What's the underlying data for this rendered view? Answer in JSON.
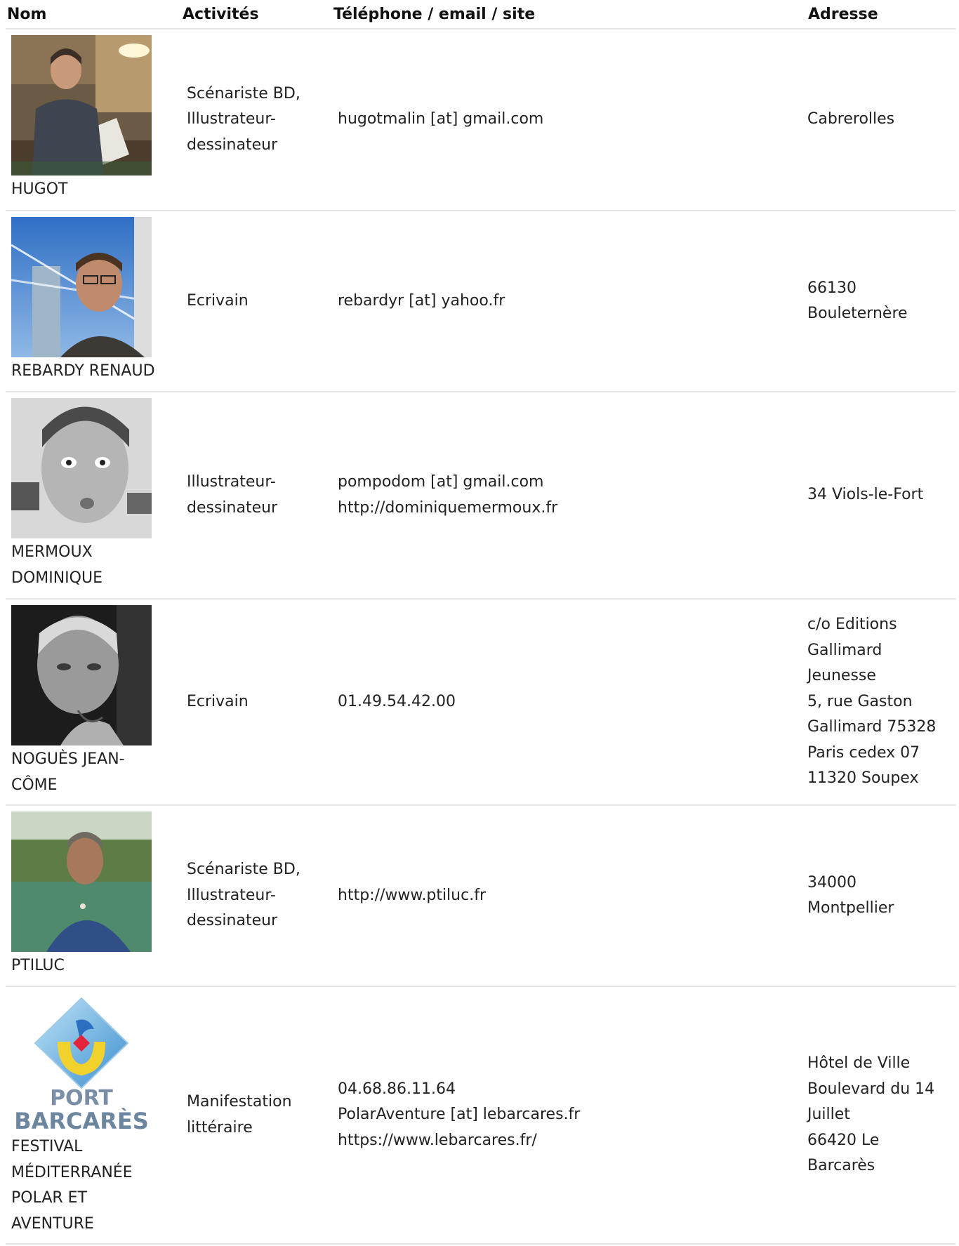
{
  "headers": {
    "nom": "Nom",
    "activites": "Activités",
    "contact": "Téléphone / email / site",
    "adresse": "Adresse"
  },
  "rows": [
    {
      "photo_icon": "person-drawing-at-desk-photo",
      "name_lines": [
        "HUGOT"
      ],
      "activity_lines": [
        "Scénariste BD,",
        "Illustrateur-",
        "dessinateur"
      ],
      "contact_lines": [
        "hugotmalin [at] gmail.com"
      ],
      "address_lines": [
        "Cabrerolles"
      ]
    },
    {
      "photo_icon": "man-with-glasses-photo",
      "name_lines": [
        "REBARDY RENAUD"
      ],
      "activity_lines": [
        "Ecrivain"
      ],
      "contact_lines": [
        "rebardyr [at] yahoo.fr"
      ],
      "address_lines": [
        "66130",
        "Bouleternère"
      ]
    },
    {
      "photo_icon": "young-man-bw-photo",
      "name_lines": [
        "MERMOUX",
        "DOMINIQUE"
      ],
      "activity_lines": [
        "Illustrateur-",
        "dessinateur"
      ],
      "contact_lines": [
        "pompodom [at] gmail.com",
        "http://dominiquemermoux.fr"
      ],
      "address_lines": [
        "34 Viols-le-Fort"
      ]
    },
    {
      "photo_icon": "older-man-bw-photo",
      "name_lines": [
        "NOGUÈS JEAN-",
        "CÔME"
      ],
      "activity_lines": [
        "Ecrivain"
      ],
      "contact_lines": [
        "01.49.54.42.00"
      ],
      "address_lines": [
        "c/o Editions",
        "Gallimard",
        "Jeunesse",
        "5, rue Gaston",
        "Gallimard 75328",
        "Paris cedex 07",
        "11320 Soupex"
      ]
    },
    {
      "photo_icon": "man-by-river-photo",
      "name_lines": [
        "PTILUC"
      ],
      "activity_lines": [
        "Scénariste BD,",
        "Illustrateur-",
        "dessinateur"
      ],
      "contact_lines": [
        "http://www.ptiluc.fr"
      ],
      "address_lines": [
        "34000",
        "Montpellier"
      ]
    },
    {
      "photo_icon": "port-barcares-logo",
      "logo_text": [
        "PORT",
        "BARCARÈS"
      ],
      "name_lines": [
        "FESTIVAL",
        "MÉDITERRANÉE",
        "POLAR ET",
        "AVENTURE"
      ],
      "activity_lines": [
        "Manifestation",
        "littéraire"
      ],
      "contact_lines": [
        "04.68.86.11.64",
        "PolarAventure [at] lebarcares.fr",
        "https://www.lebarcares.fr/"
      ],
      "address_lines": [
        "Hôtel de Ville",
        "Boulevard du 14",
        "Juillet",
        "66420 Le",
        "Barcarès"
      ]
    }
  ]
}
